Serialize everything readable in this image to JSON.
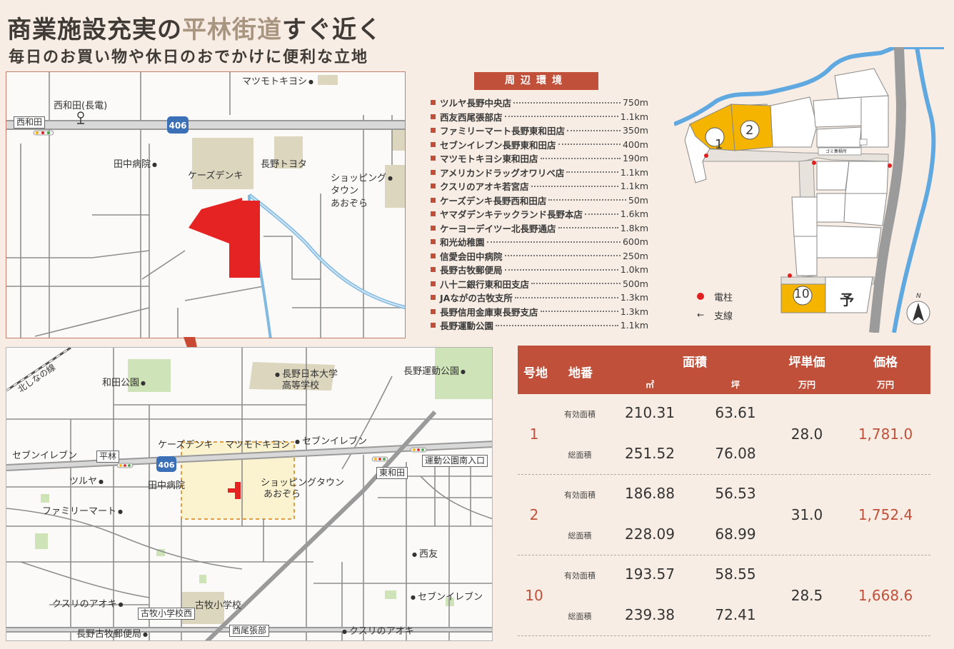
{
  "headline": {
    "pre": "商業施設充実の",
    "highlight": "平林街道",
    "post": "すぐ近く"
  },
  "subheadline": "毎日のお買い物や休日のおでかけに便利な立地",
  "map_top": {
    "labels": {
      "nishiwada_box": "西和田",
      "nishiwada_stop": "西和田(長電)",
      "matsumoto": "マツモトキヨシ",
      "route": "406",
      "tanaka": "田中病院",
      "ksdenki": "ケーズデンキ",
      "nagano_toyota": "長野トヨタ",
      "shop1": "ショッピング",
      "shop2": "タウン",
      "shop3": "あおぞら"
    }
  },
  "map_bottom": {
    "labels": {
      "kitashinano": "北しなの線",
      "wada_park": "和田公園",
      "nihon_daigaku1": "長野日本大学",
      "nihon_daigaku2": "高等学校",
      "undo_park": "長野運動公園",
      "seven1": "セブンイレブン",
      "hirabayashi": "平林",
      "route": "406",
      "ksdenki": "ケーズデンキ",
      "matsumoto": "マツモトキヨシ",
      "seven2": "セブンイレブン",
      "undo_minami": "運動公園南入口",
      "higashiwada": "東和田",
      "tsuruya": "ツルヤ",
      "tanaka": "田中病院",
      "shoppingtown1": "ショッピングタウン",
      "shoppingtown2": "あおぞら",
      "familymart": "ファミリーマート",
      "saiyu": "西友",
      "seven3": "セブンイレブン",
      "kusuri1": "クスリのアオキ",
      "furumaki_school": "古牧小学校",
      "furumaki_west": "古牧小学校西",
      "post": "長野古牧郵便局",
      "nishiobari": "西尾張部",
      "kusuri2": "クスリのアオキ"
    }
  },
  "environment": {
    "header": "周辺環境",
    "items": [
      {
        "name": "ツルヤ長野中央店",
        "distance": "750m"
      },
      {
        "name": "西友西尾張部店",
        "distance": "1.1km"
      },
      {
        "name": "ファミリーマート長野東和田店",
        "distance": "350m"
      },
      {
        "name": "セブンイレブン長野東和田店",
        "distance": "400m"
      },
      {
        "name": "マツモトキヨシ東和田店",
        "distance": "190m"
      },
      {
        "name": "アメリカンドラッグオワリベ店",
        "distance": "1.1km"
      },
      {
        "name": "クスリのアオキ若宮店",
        "distance": "1.1km"
      },
      {
        "name": "ケーズデンキ長野西和田店",
        "distance": "50m"
      },
      {
        "name": "ヤマダデンキテックランド長野本店",
        "distance": "1.6km"
      },
      {
        "name": "ケーヨーデイツー北長野通店",
        "distance": "1.8km"
      },
      {
        "name": "和光幼稚園",
        "distance": "600m"
      },
      {
        "name": "信愛会田中病院",
        "distance": "250m"
      },
      {
        "name": "長野古牧郵便局",
        "distance": "1.0km"
      },
      {
        "name": "八十二銀行東和田支店",
        "distance": "500m"
      },
      {
        "name": "JAながの古牧支所",
        "distance": "1.3km"
      },
      {
        "name": "長野信用金庫東長野支店",
        "distance": "1.3km"
      },
      {
        "name": "長野運動公園",
        "distance": "1.1km"
      }
    ]
  },
  "plot_map": {
    "lot1": "1",
    "lot2": "2",
    "lot10": "10",
    "reserved": "予",
    "garbage": "ゴミ集積所",
    "north": "N",
    "legend_pole": "電柱",
    "legend_wire": "支線",
    "colors": {
      "lot": "#f4b400",
      "water": "#5fa8e0",
      "road": "#9b9b9b"
    }
  },
  "price_table": {
    "headers": {
      "lot_no": "号地",
      "chiban": "地番",
      "area": "面積",
      "area_m2": "㎡",
      "area_tsubo": "坪",
      "tsubo_price": "坪単価",
      "tsubo_unit": "万円",
      "price": "価格",
      "price_unit": "万円"
    },
    "rows": [
      {
        "lot": "1",
        "eff_label": "有効面積",
        "eff_m2": "210.31",
        "eff_tsubo": "63.61",
        "tot_label": "総面積",
        "tot_m2": "251.52",
        "tot_tsubo": "76.08",
        "unit_price": "28.0",
        "price": "1,781.0"
      },
      {
        "lot": "2",
        "eff_label": "有効面積",
        "eff_m2": "186.88",
        "eff_tsubo": "56.53",
        "tot_label": "総面積",
        "tot_m2": "228.09",
        "tot_tsubo": "68.99",
        "unit_price": "31.0",
        "price": "1,752.4"
      },
      {
        "lot": "10",
        "eff_label": "有効面積",
        "eff_m2": "193.57",
        "eff_tsubo": "58.55",
        "tot_label": "総面積",
        "tot_m2": "239.38",
        "tot_tsubo": "72.41",
        "unit_price": "28.5",
        "price": "1,668.6"
      }
    ]
  },
  "accent": "#c0503a"
}
